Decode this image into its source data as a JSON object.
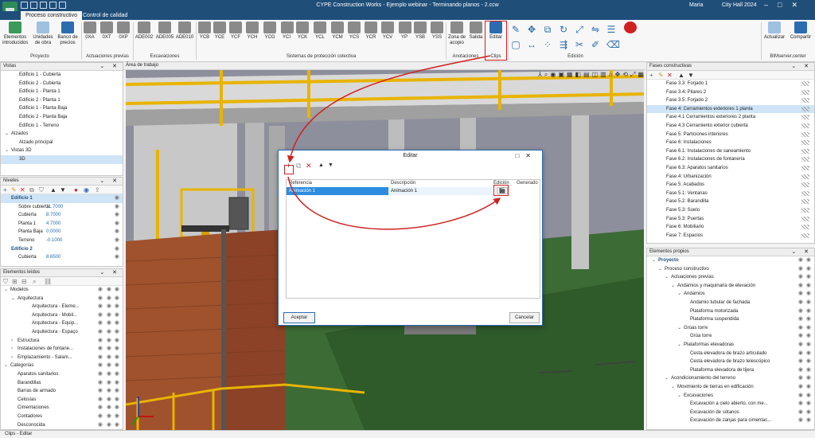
{
  "app": {
    "title": "CYPE Construction Works - Ejemplo webinar - Terminando planos - 2.ccw",
    "user": "Maria",
    "project": "City Hall 2024"
  },
  "tabs": [
    "Proceso constructivo",
    "Control de calidad"
  ],
  "ribbon": {
    "groups": {
      "proyecto": "Proyecto",
      "actuaciones": "Actuaciones previas",
      "excavaciones": "Excavaciones",
      "sistemas": "Sistemas de protección colectiva",
      "anotaciones": "Anotaciones",
      "clips": "Clips",
      "edicion": "Edición",
      "bim": "BIMserver.center"
    },
    "buttons": {
      "elementos": "Elementos introducidos",
      "unidades": "Unidades de obra",
      "banco": "Banco de precios",
      "oxa": "0XA",
      "oxt": "0XT",
      "oxp": "0XP",
      "ade002": "ADE002",
      "ade005": "ADE005",
      "ade010": "ADE010",
      "ycb": "YCB",
      "yce": "YCE",
      "ycf": "YCF",
      "ych": "YCH",
      "ycg": "YCG",
      "yci": "YCI",
      "yck": "YCK",
      "ycl": "YCL",
      "ycm": "YCM",
      "ycs": "YCS",
      "ycr": "YCR",
      "ycv": "YCV",
      "yp": "YP",
      "ysb": "YSB",
      "yss": "YSS",
      "zona": "Zona de acopio",
      "salida": "Salida",
      "editar": "Editar",
      "actualizar": "Actualizar",
      "compartir": "Compartir"
    }
  },
  "vistas": {
    "header": "Vistas",
    "items": [
      {
        "label": "Edificio 1 - Cubierta",
        "indent": 2
      },
      {
        "label": "Edificio 2 - Cubierta",
        "indent": 2
      },
      {
        "label": "Edificio 1 - Planta 1",
        "indent": 2
      },
      {
        "label": "Edificio 2 - Planta 1",
        "indent": 2
      },
      {
        "label": "Edificio 1 - Planta Baja",
        "indent": 2
      },
      {
        "label": "Edificio 2 - Planta Baja",
        "indent": 2
      },
      {
        "label": "Edificio 1 - Terreno",
        "indent": 2
      },
      {
        "label": "Alzados",
        "indent": 1,
        "toggle": "⌄"
      },
      {
        "label": "Alzado principal",
        "indent": 2
      },
      {
        "label": "Vistas 3D",
        "indent": 1,
        "toggle": "⌄"
      },
      {
        "label": "3D",
        "indent": 2,
        "selected": true
      }
    ]
  },
  "niveles": {
    "header": "Niveles",
    "items": [
      {
        "label": "Edificio 1",
        "value": "",
        "bold": true,
        "selected": true
      },
      {
        "label": "Sobre cubierta",
        "value": "11.7000"
      },
      {
        "label": "Cubierta",
        "value": "8.7000"
      },
      {
        "label": "Planta 1",
        "value": "4.7000"
      },
      {
        "label": "Planta Baja",
        "value": "0.0000"
      },
      {
        "label": "Terreno",
        "value": "-0.1000"
      },
      {
        "label": "Edificio 2",
        "value": "",
        "bold": true
      },
      {
        "label": "Cubierta",
        "value": "8.6500"
      }
    ]
  },
  "leidos": {
    "header": "Elementos leídos",
    "items": [
      {
        "label": "Modelos",
        "indent": 0,
        "toggle": "⌄"
      },
      {
        "label": "Arquitectura",
        "indent": 1,
        "toggle": "⌄"
      },
      {
        "label": "Arquitectura - Eleme...",
        "indent": 3
      },
      {
        "label": "Arquitectura - Mobil...",
        "indent": 3
      },
      {
        "label": "Arquitectura - Equip...",
        "indent": 3
      },
      {
        "label": "Arquitectura - Espaço",
        "indent": 3
      },
      {
        "label": "Estructura",
        "indent": 1,
        "toggle": "›"
      },
      {
        "label": "Instalaciones de fontane...",
        "indent": 1,
        "toggle": "›"
      },
      {
        "label": "Emplazamiento - Salam...",
        "indent": 1,
        "toggle": "›"
      },
      {
        "label": "Categorías",
        "indent": 0,
        "toggle": "⌄"
      },
      {
        "label": "Aparatos sanitarios",
        "indent": 1
      },
      {
        "label": "Barandillas",
        "indent": 1
      },
      {
        "label": "Barras de armado",
        "indent": 1
      },
      {
        "label": "Celosías",
        "indent": 1
      },
      {
        "label": "Cimentaciones",
        "indent": 1
      },
      {
        "label": "Contadores",
        "indent": 1
      },
      {
        "label": "Desconocida",
        "indent": 1
      }
    ]
  },
  "viewport": {
    "header": "Área de trabajo"
  },
  "fases": {
    "header": "Fases constructivas",
    "items": [
      {
        "label": "Fase 3.3: Forjado 1"
      },
      {
        "label": "Fase 3.4: Pilares 2"
      },
      {
        "label": "Fase 3.5: Forjado 2"
      },
      {
        "label": "Fase 4: Cerramientos exteriores 1 planta",
        "selected": true
      },
      {
        "label": "Fase 4.1 Cerramientos exteriores 2 planta"
      },
      {
        "label": "Fase 4.3 Cerramiento exterior cubierta"
      },
      {
        "label": "Fase 5: Particiones interiores"
      },
      {
        "label": "Fase 6: Instalaciones"
      },
      {
        "label": "Fase 6.1: Instalaciones de saneamiento"
      },
      {
        "label": "Fase 6.2: Instalaciones de fontanería"
      },
      {
        "label": "Fase 6.3: Aparatos sanitarios"
      },
      {
        "label": "Fase 4: Urbanización"
      },
      {
        "label": "Fase 5: Acabados"
      },
      {
        "label": "Fase 5.1: Ventanas"
      },
      {
        "label": "Fase 5.2: Barandilla"
      },
      {
        "label": "Fase 5.3: Suelo"
      },
      {
        "label": "Fase 5.3: Puertas"
      },
      {
        "label": "Fase 6: Mobiliario"
      },
      {
        "label": "Fase 7: Espacios"
      }
    ]
  },
  "propios": {
    "header": "Elementos propios",
    "items": [
      {
        "label": "Proyecto",
        "indent": 0,
        "toggle": "⌄",
        "bold": true
      },
      {
        "label": "Proceso constructivo",
        "indent": 1,
        "toggle": "⌄"
      },
      {
        "label": "Actuaciones previas",
        "indent": 2,
        "toggle": "⌄"
      },
      {
        "label": "Andamios y maquinaria de elevación",
        "indent": 3,
        "toggle": "⌄"
      },
      {
        "label": "Andamios",
        "indent": 4,
        "toggle": "⌄"
      },
      {
        "label": "Andamio tubular de fachada",
        "indent": 5
      },
      {
        "label": "Plataforma motorizada",
        "indent": 5
      },
      {
        "label": "Plataforma suspendida",
        "indent": 5
      },
      {
        "label": "Grúas torre",
        "indent": 4,
        "toggle": "⌄"
      },
      {
        "label": "Grúa torre",
        "indent": 5
      },
      {
        "label": "Plataformas elevadoras",
        "indent": 4,
        "toggle": "⌄"
      },
      {
        "label": "Cesta elevadora de brazo articulado",
        "indent": 5
      },
      {
        "label": "Cesta elevadora de brazo telescópico",
        "indent": 5
      },
      {
        "label": "Plataforma elevadora de tijera",
        "indent": 5
      },
      {
        "label": "Acondicionamiento del terreno",
        "indent": 2,
        "toggle": "⌄"
      },
      {
        "label": "Movimiento de tierras en edificación",
        "indent": 3,
        "toggle": "⌄"
      },
      {
        "label": "Excavaciones",
        "indent": 4,
        "toggle": "⌄"
      },
      {
        "label": "Excavación a cielo abierto, con me...",
        "indent": 5
      },
      {
        "label": "Excavación de sótanos",
        "indent": 5
      },
      {
        "label": "Excavación de zanjas para cimentac...",
        "indent": 5
      }
    ]
  },
  "dialog": {
    "title": "Editar",
    "columns": {
      "referencia": "Referencia",
      "descripcion": "Descripción",
      "edicion": "Edición",
      "generado": "Generado"
    },
    "rows": [
      {
        "referencia": "Animación 1",
        "descripcion": "Animación 1"
      }
    ],
    "accept": "Aceptar",
    "cancel": "Cancelar"
  },
  "status": "Clips - Editar",
  "colors": {
    "accent": "#1f4e79",
    "highlight": "#d02020",
    "selection": "#2b8ce0"
  }
}
